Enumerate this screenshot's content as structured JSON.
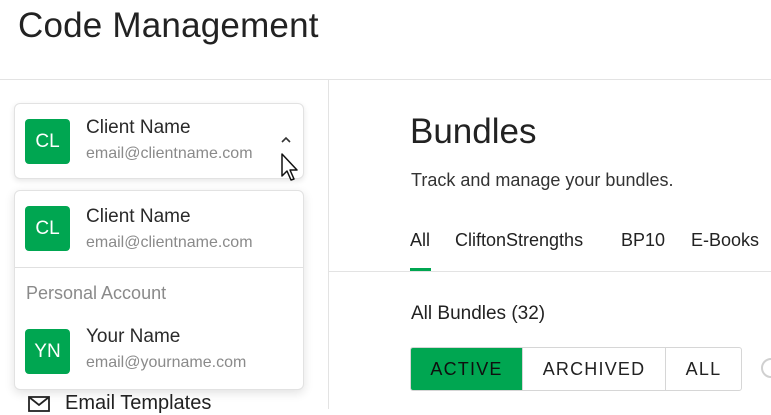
{
  "page": {
    "title": "Code Management"
  },
  "account_selector": {
    "current": {
      "initials": "CL",
      "name": "Client Name",
      "email": "email@clientname.com"
    },
    "icon": "chevron-up-icon"
  },
  "dropdown": {
    "items": [
      {
        "initials": "CL",
        "name": "Client Name",
        "email": "email@clientname.com"
      }
    ],
    "personal_section_label": "Personal Account",
    "personal": {
      "initials": "YN",
      "name": "Your Name",
      "email": "email@yourname.com"
    }
  },
  "sidebar": {
    "email_templates": {
      "label": "Email Templates",
      "icon": "mail-icon"
    }
  },
  "main": {
    "title": "Bundles",
    "subtitle": "Track and manage your bundles.",
    "tabs": [
      "All",
      "CliftonStrengths",
      "BP10",
      "E-Books"
    ],
    "active_tab": "All",
    "section_count": "All Bundles (32)",
    "filters": [
      "ACTIVE",
      "ARCHIVED",
      "ALL"
    ],
    "active_filter": "ACTIVE"
  },
  "colors": {
    "accent": "#00a651",
    "divider": "#e3e3e3",
    "muted_text": "#8a8a8a"
  }
}
